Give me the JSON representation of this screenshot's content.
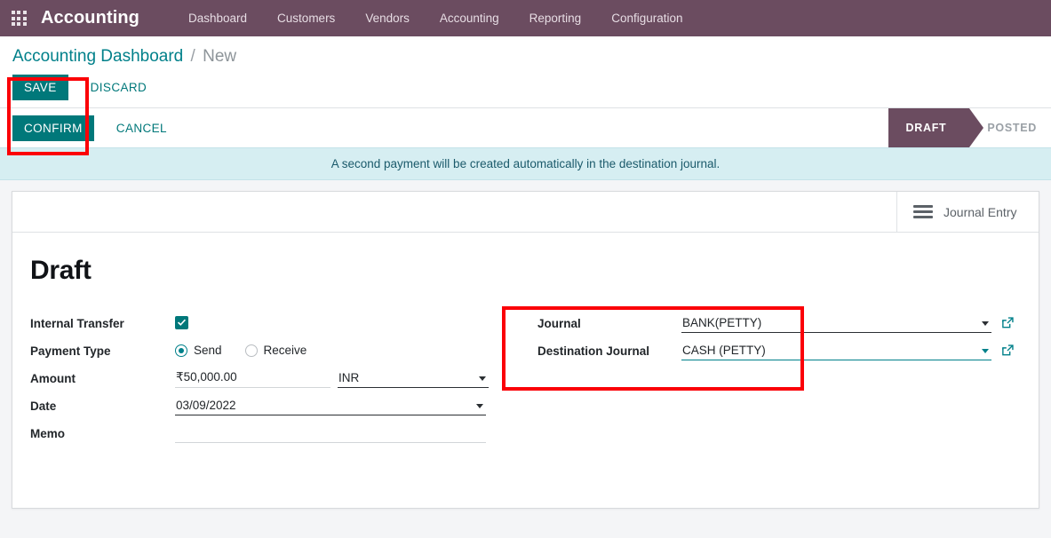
{
  "navbar": {
    "apps_icon": "apps-grid-icon",
    "brand": "Accounting",
    "menu_items": [
      {
        "label": "Dashboard"
      },
      {
        "label": "Customers"
      },
      {
        "label": "Vendors"
      },
      {
        "label": "Accounting"
      },
      {
        "label": "Reporting"
      },
      {
        "label": "Configuration"
      }
    ]
  },
  "breadcrumb": {
    "parent": "Accounting Dashboard",
    "separator": "/",
    "current": "New"
  },
  "actions": {
    "save_label": "SAVE",
    "discard_label": "DISCARD",
    "confirm_label": "CONFIRM",
    "cancel_label": "CANCEL"
  },
  "statusbar": {
    "steps": [
      {
        "label": "DRAFT",
        "active": true
      },
      {
        "label": "POSTED",
        "active": false
      }
    ]
  },
  "alert": {
    "message": "A second payment will be created automatically in the destination journal."
  },
  "sheet": {
    "smart_button": {
      "icon": "list-lines-icon",
      "label": "Journal Entry"
    },
    "record_title": "Draft",
    "left_fields": {
      "internal_transfer": {
        "label": "Internal Transfer",
        "checked": true
      },
      "payment_type": {
        "label": "Payment Type",
        "options": [
          {
            "label": "Send",
            "selected": true
          },
          {
            "label": "Receive",
            "selected": false
          }
        ]
      },
      "amount": {
        "label": "Amount",
        "value": "₹50,000.00",
        "currency": "INR"
      },
      "date": {
        "label": "Date",
        "value": "03/09/2022"
      },
      "memo": {
        "label": "Memo",
        "value": "",
        "placeholder": ""
      }
    },
    "right_fields": {
      "journal": {
        "label": "Journal",
        "value": "BANK(PETTY)",
        "external_link_icon": "external-link-icon"
      },
      "destination_journal": {
        "label": "Destination Journal",
        "value": "CASH (PETTY)",
        "focused": true,
        "external_link_icon": "external-link-icon"
      }
    }
  },
  "annotations": [
    {
      "name": "highlight-save-confirm-buttons",
      "color": "#fb0007"
    },
    {
      "name": "highlight-journal-fields",
      "color": "#fb0007"
    }
  ],
  "colors": {
    "navbar_purple": "#6b4c60",
    "accent_teal": "#00787a",
    "link_teal": "#00808a",
    "alert_bg": "#d6eef2",
    "annotation_red": "#fb0007"
  }
}
